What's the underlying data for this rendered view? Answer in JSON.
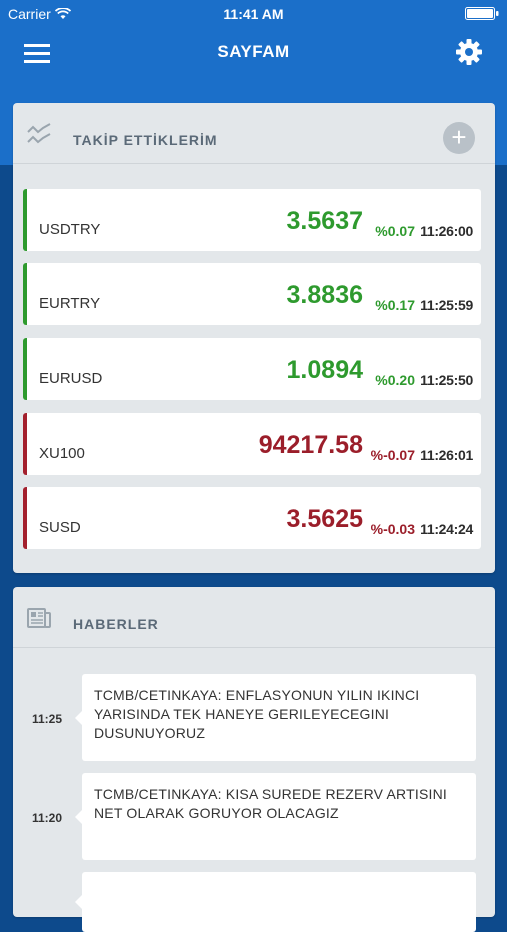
{
  "status_bar": {
    "carrier": "Carrier",
    "time": "11:41 AM"
  },
  "nav": {
    "title": "SAYFAM"
  },
  "watchlist": {
    "title": "TAKİP ETTİKLERİM",
    "add_symbol": "+",
    "items": [
      {
        "symbol": "USDTRY",
        "price": "3.5637",
        "change": "%0.07",
        "time": "11:26:00",
        "direction": "up"
      },
      {
        "symbol": "EURTRY",
        "price": "3.8836",
        "change": "%0.17",
        "time": "11:25:59",
        "direction": "up"
      },
      {
        "symbol": "EURUSD",
        "price": "1.0894",
        "change": "%0.20",
        "time": "11:25:50",
        "direction": "up"
      },
      {
        "symbol": "XU100",
        "price": "94217.58",
        "change": "%-0.07",
        "time": "11:26:01",
        "direction": "down"
      },
      {
        "symbol": "SUSD",
        "price": "3.5625",
        "change": "%-0.03",
        "time": "11:24:24",
        "direction": "down"
      }
    ]
  },
  "news": {
    "title": "HABERLER",
    "items": [
      {
        "time": "11:25",
        "text": "TCMB/CETINKAYA: ENFLASYONUN YILIN IKINCI YARISINDA TEK HANEYE GERILEYECEGINI DUSUNUYORUZ"
      },
      {
        "time": "11:20",
        "text": "TCMB/CETINKAYA: KISA SUREDE REZERV ARTISINI NET OLARAK GORUYOR OLACAGIZ"
      }
    ]
  },
  "colors": {
    "up": "#2e9a2e",
    "down": "#9b1e2a",
    "header": "#1b6fc9"
  }
}
